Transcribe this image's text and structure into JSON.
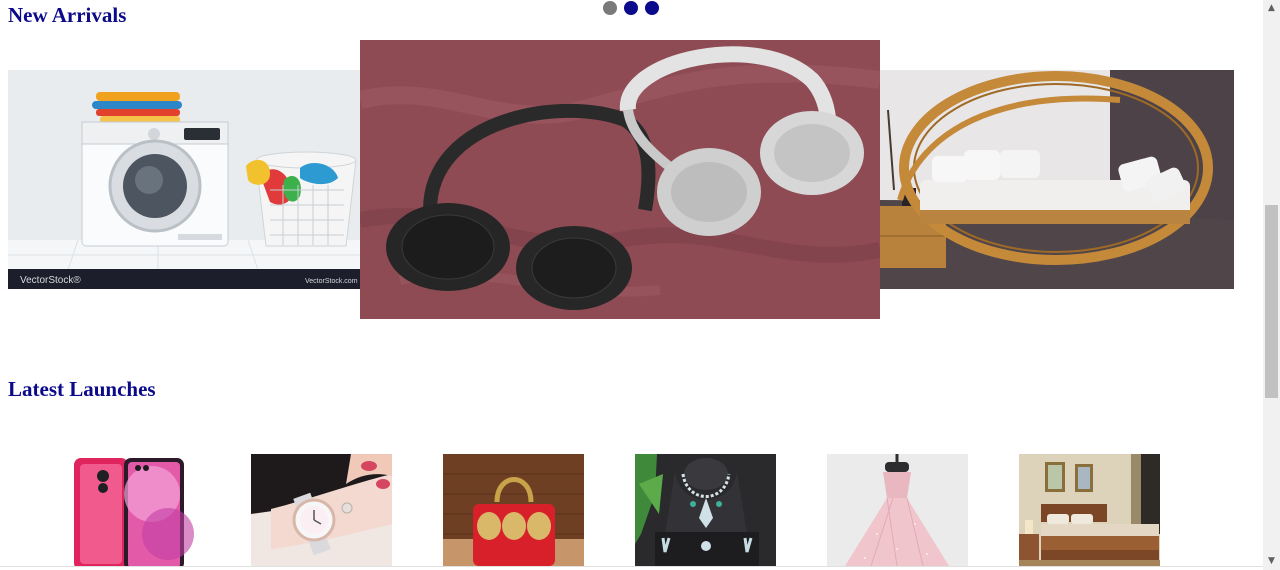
{
  "sections": {
    "new_arrivals_title": "New Arrivals",
    "latest_launches_title": "Latest Launches"
  },
  "carousel": {
    "dot_count": 3,
    "active_dot": 1,
    "slides": [
      {
        "name": "washing-machine",
        "watermark_left": "VectorStock®",
        "watermark_right": "VectorStock.com"
      },
      {
        "name": "headphones"
      },
      {
        "name": "bed"
      }
    ]
  },
  "latest_launches": [
    "phone",
    "watch",
    "handbag",
    "jewellery",
    "dress",
    "bed"
  ],
  "colors": {
    "heading": "#0b0b8a",
    "dot_active": "#7a7a7a",
    "dot_inactive": "#0a0a8c"
  }
}
